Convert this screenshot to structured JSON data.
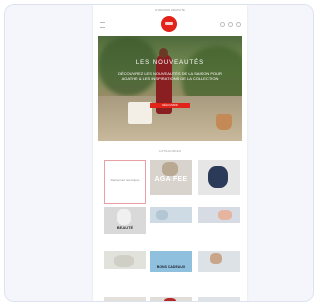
{
  "top": {
    "promo_text": "LIVRAISON GRATUITE"
  },
  "hero": {
    "title": "LES NOUVEAUTÉS",
    "text": "DÉCOUVREZ LES NOUVEAUTÉS DE LA SAISON POUR AGATHE & LES INSPIRATIONS DE LA COLLECTION",
    "cta_label": "DÉCOUVRIR"
  },
  "section": {
    "title": "CATÉGORIES"
  },
  "tiles": [
    {
      "label": "Découvrez nos bijoux"
    },
    {
      "label": "AGA FEE"
    },
    {
      "label": ""
    },
    {
      "label": "BEAUTÉ"
    },
    {
      "label": ""
    },
    {
      "label": ""
    },
    {
      "label": ""
    },
    {
      "label": "BONS CADEAUX"
    },
    {
      "label": ""
    },
    {
      "label": ""
    },
    {
      "label": ""
    },
    {
      "label": ""
    }
  ]
}
